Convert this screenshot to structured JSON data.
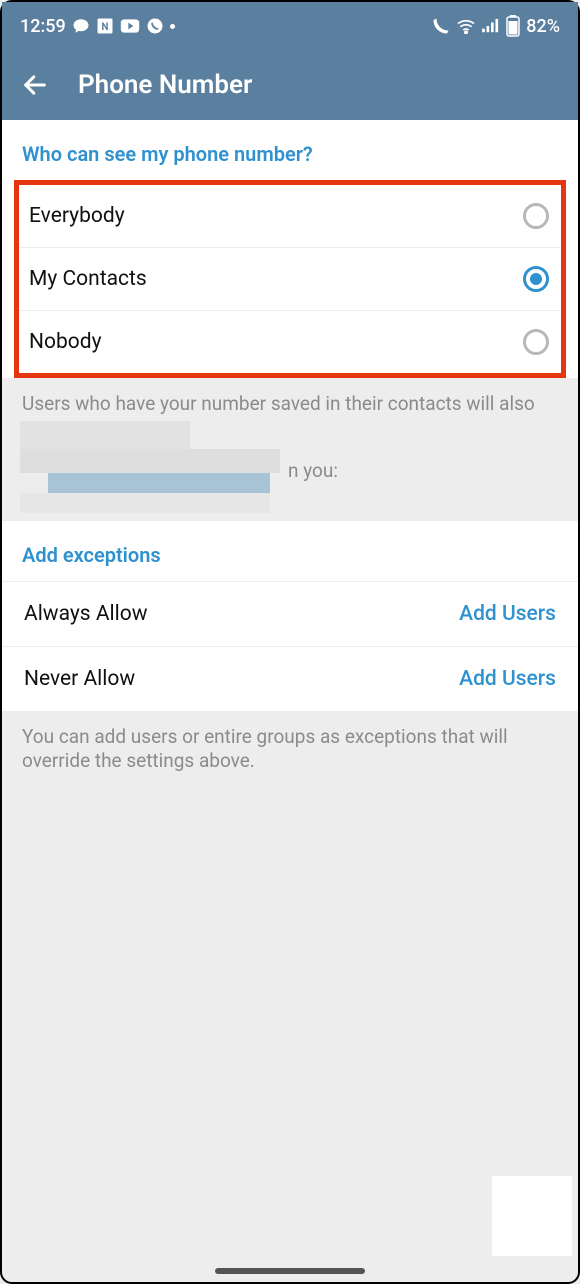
{
  "status": {
    "time": "12:59",
    "battery": "82%"
  },
  "appbar": {
    "title": "Phone Number"
  },
  "visibility": {
    "header": "Who can see my phone number?",
    "options": [
      {
        "label": "Everybody",
        "selected": false
      },
      {
        "label": "My Contacts",
        "selected": true
      },
      {
        "label": "Nobody",
        "selected": false
      }
    ],
    "desc_line": "Users who have your number saved in their contacts will also",
    "desc_tail": "n you:"
  },
  "exceptions": {
    "header": "Add exceptions",
    "rows": [
      {
        "label": "Always Allow",
        "action": "Add Users"
      },
      {
        "label": "Never Allow",
        "action": "Add Users"
      }
    ],
    "desc": "You can add users or entire groups as exceptions that will override the settings above."
  }
}
